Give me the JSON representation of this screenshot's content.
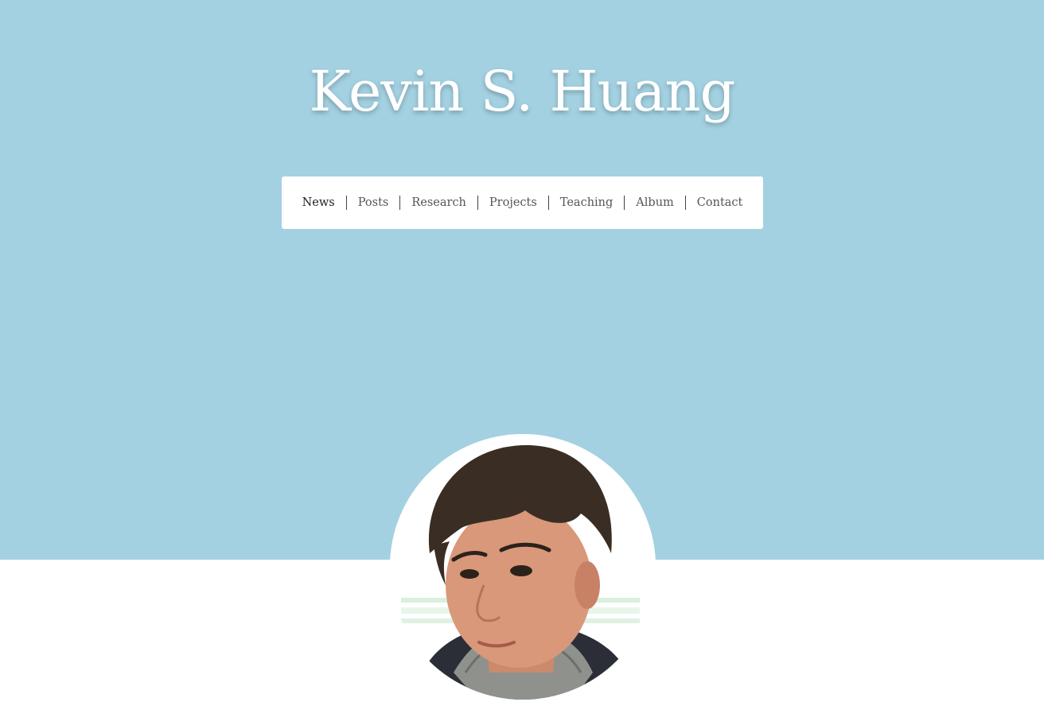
{
  "site": {
    "title": "Kevin S. Huang"
  },
  "nav": {
    "items": [
      {
        "label": "News",
        "active": true
      },
      {
        "label": "Posts",
        "active": false
      },
      {
        "label": "Research",
        "active": false
      },
      {
        "label": "Projects",
        "active": false
      },
      {
        "label": "Teaching",
        "active": false
      },
      {
        "label": "Album",
        "active": false
      },
      {
        "label": "Contact",
        "active": false
      }
    ]
  },
  "colors": {
    "hero_background": "#a3d1e1",
    "title_text": "#ffffff",
    "nav_background": "#ffffff",
    "nav_text": "#555555",
    "nav_active_text": "#222222"
  },
  "avatar": {
    "kind": "profile-photo"
  }
}
